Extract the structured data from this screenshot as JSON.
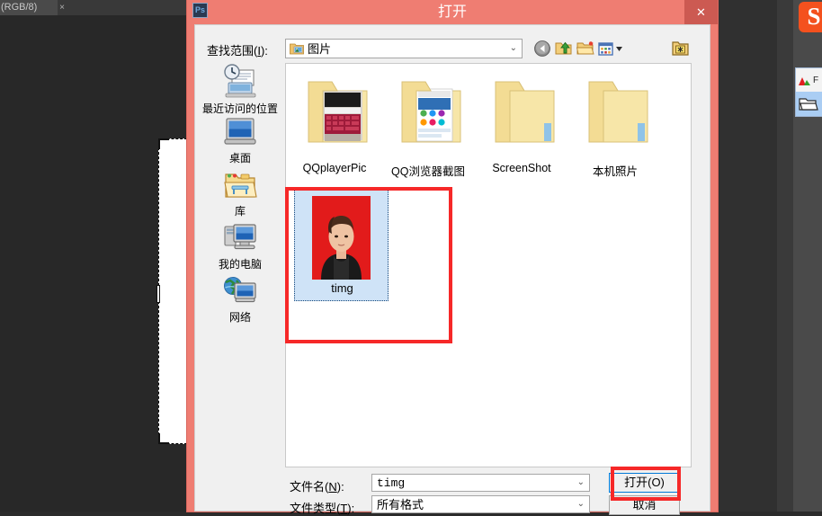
{
  "photoshop": {
    "document_tab_label": "(RGB/8)",
    "tab_close_glyph": "×",
    "snapseed_logo_letter": "S",
    "popup_item_label": "F"
  },
  "dialog": {
    "title": "打开",
    "app_icon_text": "Ps",
    "close_glyph": "✕",
    "lookin": {
      "label_pre": "查找范围(",
      "label_key": "I",
      "label_post": "):",
      "value": "图片",
      "dropdown_glyph": "⌄"
    },
    "toolbar": [
      {
        "name": "back-button",
        "title": "后退"
      },
      {
        "name": "up-folder-button",
        "title": "向上一级"
      },
      {
        "name": "new-folder-button",
        "title": "新建文件夹"
      },
      {
        "name": "view-mode-button",
        "title": "视图"
      },
      {
        "name": "extra-folder-button",
        "title": "文件夹"
      }
    ],
    "places": [
      {
        "label": "最近访问的位置",
        "icon": "recent-places-icon"
      },
      {
        "label": "桌面",
        "icon": "desktop-icon"
      },
      {
        "label": "库",
        "icon": "library-icon"
      },
      {
        "label": "我的电脑",
        "icon": "my-computer-icon"
      },
      {
        "label": "网络",
        "icon": "network-icon"
      }
    ],
    "folders": [
      {
        "label": "QQplayerPic",
        "type": "photo-folder"
      },
      {
        "label": "QQ浏览器截图",
        "type": "photo-folder"
      },
      {
        "label": "ScreenShot",
        "type": "plain-folder"
      },
      {
        "label": "本机照片",
        "type": "plain-folder"
      }
    ],
    "selected_file": {
      "label": "timg",
      "selected": true,
      "thumbnail_background": "#e21b1b"
    },
    "filename": {
      "label_pre": "文件名(",
      "label_key": "N",
      "label_post": "):",
      "value": "timg",
      "dropdown_glyph": "⌄"
    },
    "filetype": {
      "label_pre": "文件类型(",
      "label_key": "T",
      "label_post": "):",
      "value": "所有格式",
      "dropdown_glyph": "⌄"
    },
    "open_button_label": "打开(O)",
    "cancel_button_label": "取消"
  },
  "colors": {
    "titlebar": "#ef7d72",
    "close_button": "#cc5a52",
    "annotation": "#f62828",
    "focus_ring": "#0078d7",
    "selection_fill": "#cfe3f7",
    "dialog_bg": "#f0f0f0"
  }
}
